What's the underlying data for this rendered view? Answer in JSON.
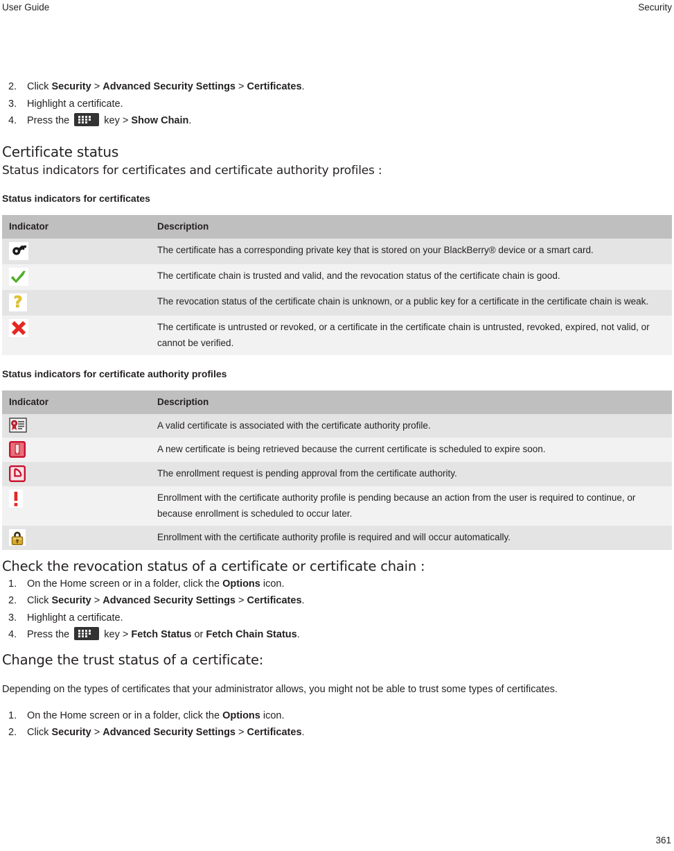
{
  "running_head": {
    "left": "User Guide",
    "right": "Security"
  },
  "top_steps": [
    {
      "num": "2.",
      "parts": [
        {
          "t": "Click ",
          "b": false
        },
        {
          "t": "Security",
          "b": true
        },
        {
          "t": " > ",
          "b": false
        },
        {
          "t": "Advanced Security Settings",
          "b": true
        },
        {
          "t": " > ",
          "b": false
        },
        {
          "t": "Certificates",
          "b": true
        },
        {
          "t": ".",
          "b": false
        }
      ]
    },
    {
      "num": "3.",
      "parts": [
        {
          "t": "Highlight a certificate.",
          "b": false
        }
      ]
    },
    {
      "num": "4.",
      "parts": [
        {
          "t": "Press the ",
          "b": false
        },
        {
          "icon": "blackberry-menu-key"
        },
        {
          "t": " key > ",
          "b": false
        },
        {
          "t": "Show Chain",
          "b": true
        },
        {
          "t": ".",
          "b": false
        }
      ]
    }
  ],
  "section": {
    "heading": "Certificate status",
    "lead": "Status indicators for certificates and certificate authority profiles :"
  },
  "table1": {
    "title": "Status indicators for certificates",
    "columns": [
      "Indicator",
      "Description"
    ],
    "rows": [
      {
        "icon": "key-icon",
        "description": "The certificate has a corresponding private key that is stored on your BlackBerry® device or a smart card."
      },
      {
        "icon": "green-check-icon",
        "description": "The certificate chain is trusted and valid, and the revocation status of the certificate chain is good."
      },
      {
        "icon": "yellow-question-icon",
        "description": "The revocation status of the certificate chain is unknown, or a public key for a certificate in the certificate chain is weak."
      },
      {
        "icon": "red-x-icon",
        "description": "The certificate is untrusted or revoked, or a certificate in the certificate chain is untrusted, revoked, expired, not valid, or cannot be verified."
      }
    ]
  },
  "table2": {
    "title": "Status indicators for certificate authority profiles",
    "columns": [
      "Indicator",
      "Description"
    ],
    "rows": [
      {
        "icon": "certificate-icon",
        "description": "A valid certificate is associated with the certificate authority profile."
      },
      {
        "icon": "certificate-renew-icon",
        "description": "A new certificate is being retrieved because the current certificate is scheduled to expire soon."
      },
      {
        "icon": "pending-clock-icon",
        "description": "The enrollment request is pending approval from the certificate authority."
      },
      {
        "icon": "red-exclamation-icon",
        "description": "Enrollment with the certificate authority profile is pending because an action from the user is required to continue, or because enrollment is scheduled to occur later."
      },
      {
        "icon": "gold-padlock-icon",
        "description": "Enrollment with the certificate authority profile is required and will occur automatically."
      }
    ]
  },
  "proc1": {
    "heading": "Check the revocation status of a certificate or certificate chain :",
    "steps": [
      {
        "num": "1.",
        "parts": [
          {
            "t": "On the Home screen or in a folder, click the ",
            "b": false
          },
          {
            "t": "Options",
            "b": true
          },
          {
            "t": " icon.",
            "b": false
          }
        ]
      },
      {
        "num": "2.",
        "parts": [
          {
            "t": "Click ",
            "b": false
          },
          {
            "t": "Security",
            "b": true
          },
          {
            "t": " > ",
            "b": false
          },
          {
            "t": "Advanced Security Settings",
            "b": true
          },
          {
            "t": " > ",
            "b": false
          },
          {
            "t": "Certificates",
            "b": true
          },
          {
            "t": ".",
            "b": false
          }
        ]
      },
      {
        "num": "3.",
        "parts": [
          {
            "t": "Highlight a certificate.",
            "b": false
          }
        ]
      },
      {
        "num": "4.",
        "parts": [
          {
            "t": "Press the ",
            "b": false
          },
          {
            "icon": "blackberry-menu-key"
          },
          {
            "t": " key > ",
            "b": false
          },
          {
            "t": "Fetch Status",
            "b": true
          },
          {
            "t": " or ",
            "b": false
          },
          {
            "t": "Fetch Chain Status",
            "b": true
          },
          {
            "t": ".",
            "b": false
          }
        ]
      }
    ]
  },
  "proc2": {
    "heading": "Change the trust status of a certificate:",
    "paragraph": "Depending on the types of certificates that your administrator allows, you might not be able to trust some types of certificates.",
    "steps": [
      {
        "num": "1.",
        "parts": [
          {
            "t": "On the Home screen or in a folder, click the ",
            "b": false
          },
          {
            "t": "Options",
            "b": true
          },
          {
            "t": " icon.",
            "b": false
          }
        ]
      },
      {
        "num": "2.",
        "parts": [
          {
            "t": "Click ",
            "b": false
          },
          {
            "t": "Security",
            "b": true
          },
          {
            "t": " > ",
            "b": false
          },
          {
            "t": "Advanced Security Settings",
            "b": true
          },
          {
            "t": " > ",
            "b": false
          },
          {
            "t": "Certificates",
            "b": true
          },
          {
            "t": ".",
            "b": false
          }
        ]
      }
    ]
  },
  "folio": "361",
  "colors": {
    "table_header_bg": "#bfbfbf",
    "row_odd_bg": "#e4e4e4",
    "row_even_bg": "#f2f2f2",
    "text": "#231f20",
    "green_check": "#4CAF27",
    "yellow_question": "#E3C52B",
    "red_x": "#E52822",
    "red_icon": "#C8102E",
    "gold_lock": "#D6A72B",
    "bbkey_bg": "#333333"
  }
}
